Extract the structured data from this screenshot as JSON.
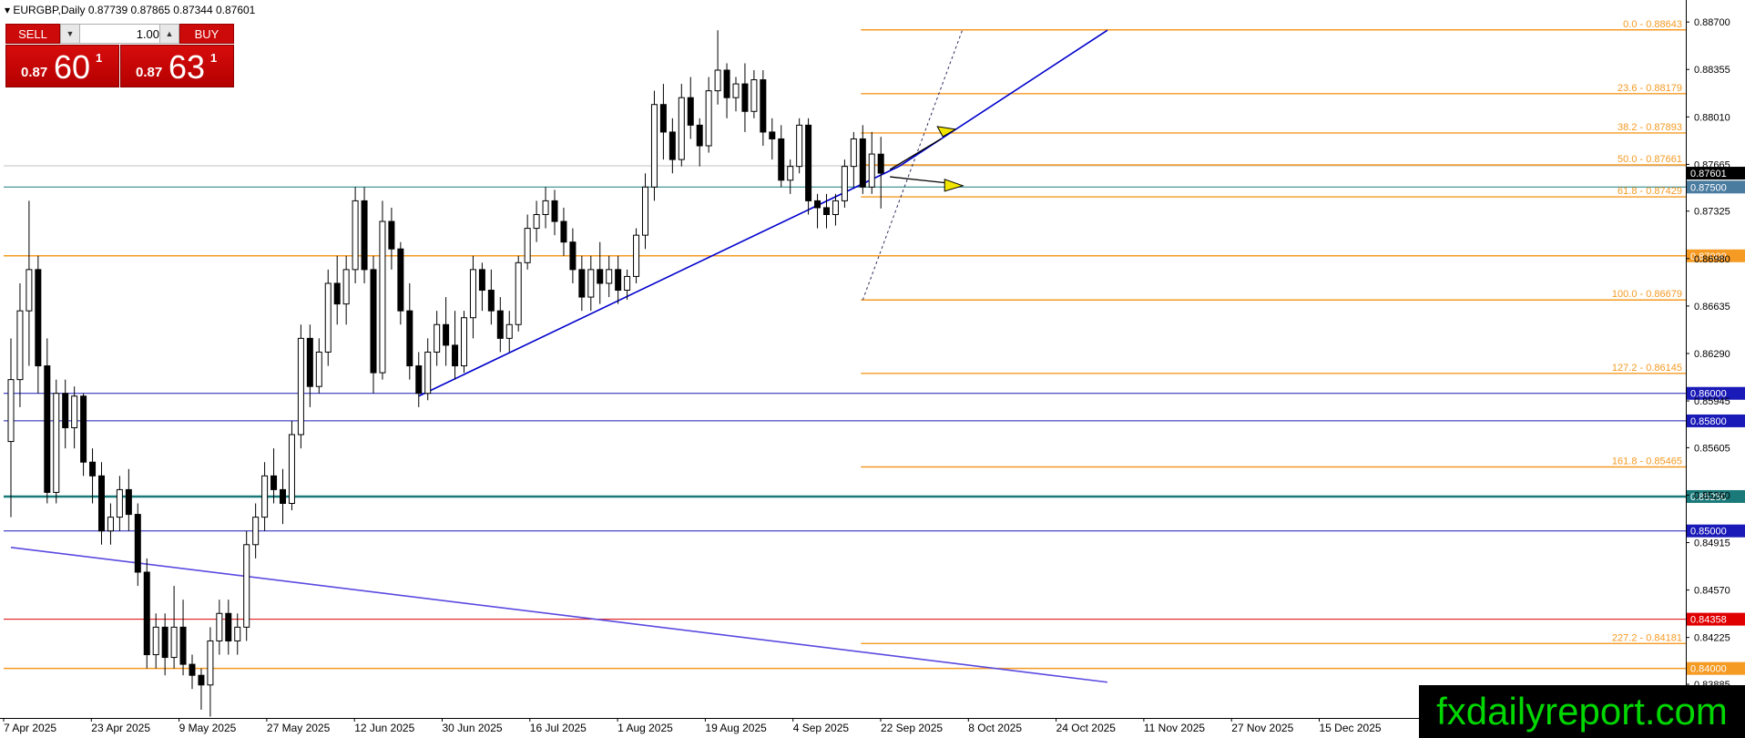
{
  "symbol_info": "EURGBP,Daily  0.87739 0.87865 0.87344 0.87601",
  "trade_panel": {
    "sell_label": "SELL",
    "buy_label": "BUY",
    "lot_value": "1.00",
    "sell_price": {
      "prefix": "0.87",
      "big": "60",
      "sup": "1"
    },
    "buy_price": {
      "prefix": "0.87",
      "big": "63",
      "sup": "1"
    }
  },
  "watermark": "fxdailyreport.com",
  "colors": {
    "fib": "#f59a23",
    "blue_level": "#1a1ab8",
    "teal_level": "#1a7a7a",
    "red_level": "#e00000",
    "trendline": "#0000cc",
    "candle": "#000000"
  },
  "chart_data": {
    "type": "candlestick",
    "symbol": "EURGBP",
    "timeframe": "Daily",
    "ohlc_header": {
      "open": 0.87739,
      "high": 0.87865,
      "low": 0.87344,
      "close": 0.87601
    },
    "price_axis_ticks": [
      "0.88700",
      "0.88355",
      "0.88010",
      "0.87665",
      "0.87325",
      "0.86980",
      "0.86635",
      "0.86290",
      "0.85945",
      "0.85605",
      "0.85260",
      "0.84915",
      "0.84570",
      "0.84225",
      "0.83885"
    ],
    "ylim": [
      0.8364,
      0.8886
    ],
    "time_axis_labels": [
      "7 Apr 2025",
      "23 Apr 2025",
      "9 May 2025",
      "27 May 2025",
      "12 Jun 2025",
      "30 Jun 2025",
      "16 Jul 2025",
      "1 Aug 2025",
      "19 Aug 2025",
      "4 Sep 2025",
      "22 Sep 2025",
      "8 Oct 2025",
      "24 Oct 2025",
      "11 Nov 2025",
      "27 Nov 2025",
      "15 Dec 2025"
    ],
    "fib_levels": [
      {
        "ratio": "0.0",
        "price": 0.88643,
        "label": "0.0 - 0.88643"
      },
      {
        "ratio": "23.6",
        "price": 0.88179,
        "label": "23.6 - 0.88179"
      },
      {
        "ratio": "38.2",
        "price": 0.87893,
        "label": "38.2 - 0.87893"
      },
      {
        "ratio": "50.0",
        "price": 0.87661,
        "label": "50.0 - 0.87661"
      },
      {
        "ratio": "61.8",
        "price": 0.87429,
        "label": "61.8 - 0.87429"
      },
      {
        "ratio": "100.0",
        "price": 0.86679,
        "label": "100.0 - 0.86679"
      },
      {
        "ratio": "127.2",
        "price": 0.86145,
        "label": "127.2 - 0.86145"
      },
      {
        "ratio": "161.8",
        "price": 0.85465,
        "label": "161.8 - 0.85465"
      },
      {
        "ratio": "227.2",
        "price": 0.84181,
        "label": "227.2 - 0.84181"
      }
    ],
    "horizontal_levels": [
      {
        "price": 0.875,
        "label": "0.87500",
        "style": "teal-thin"
      },
      {
        "price": 0.87,
        "label": "0.87000",
        "style": "orange"
      },
      {
        "price": 0.86,
        "label": "0.86000",
        "style": "blue"
      },
      {
        "price": 0.858,
        "label": "0.85800",
        "style": "blue"
      },
      {
        "price": 0.8525,
        "label": "0.85250",
        "style": "teal-thick"
      },
      {
        "price": 0.85,
        "label": "0.85000",
        "style": "blue"
      },
      {
        "price": 0.84358,
        "label": "0.84358",
        "style": "red"
      },
      {
        "price": 0.84,
        "label": "0.84000",
        "style": "orange"
      }
    ],
    "current_price": {
      "price": 0.87601,
      "label": "0.87601"
    },
    "candles": [
      {
        "o": 0.8565,
        "h": 0.864,
        "l": 0.851,
        "c": 0.861
      },
      {
        "o": 0.861,
        "h": 0.868,
        "l": 0.859,
        "c": 0.866
      },
      {
        "o": 0.866,
        "h": 0.874,
        "l": 0.862,
        "c": 0.869
      },
      {
        "o": 0.869,
        "h": 0.87,
        "l": 0.86,
        "c": 0.862
      },
      {
        "o": 0.862,
        "h": 0.864,
        "l": 0.852,
        "c": 0.8528
      },
      {
        "o": 0.8528,
        "h": 0.861,
        "l": 0.852,
        "c": 0.86
      },
      {
        "o": 0.86,
        "h": 0.861,
        "l": 0.856,
        "c": 0.8575
      },
      {
        "o": 0.8575,
        "h": 0.8605,
        "l": 0.856,
        "c": 0.8598
      },
      {
        "o": 0.8598,
        "h": 0.86,
        "l": 0.854,
        "c": 0.855
      },
      {
        "o": 0.855,
        "h": 0.856,
        "l": 0.852,
        "c": 0.854
      },
      {
        "o": 0.854,
        "h": 0.855,
        "l": 0.849,
        "c": 0.85
      },
      {
        "o": 0.85,
        "h": 0.852,
        "l": 0.849,
        "c": 0.851
      },
      {
        "o": 0.851,
        "h": 0.854,
        "l": 0.85,
        "c": 0.853
      },
      {
        "o": 0.853,
        "h": 0.8545,
        "l": 0.85,
        "c": 0.8512
      },
      {
        "o": 0.8512,
        "h": 0.852,
        "l": 0.846,
        "c": 0.847
      },
      {
        "o": 0.847,
        "h": 0.848,
        "l": 0.84,
        "c": 0.841
      },
      {
        "o": 0.841,
        "h": 0.844,
        "l": 0.84,
        "c": 0.843
      },
      {
        "o": 0.843,
        "h": 0.844,
        "l": 0.8395,
        "c": 0.8408
      },
      {
        "o": 0.8408,
        "h": 0.846,
        "l": 0.84,
        "c": 0.843
      },
      {
        "o": 0.843,
        "h": 0.845,
        "l": 0.8395,
        "c": 0.8403
      },
      {
        "o": 0.8403,
        "h": 0.841,
        "l": 0.8385,
        "c": 0.8395
      },
      {
        "o": 0.8395,
        "h": 0.84,
        "l": 0.837,
        "c": 0.8388
      },
      {
        "o": 0.8388,
        "h": 0.843,
        "l": 0.8365,
        "c": 0.842
      },
      {
        "o": 0.842,
        "h": 0.845,
        "l": 0.841,
        "c": 0.844
      },
      {
        "o": 0.844,
        "h": 0.845,
        "l": 0.841,
        "c": 0.842
      },
      {
        "o": 0.842,
        "h": 0.844,
        "l": 0.841,
        "c": 0.843
      },
      {
        "o": 0.843,
        "h": 0.85,
        "l": 0.842,
        "c": 0.849
      },
      {
        "o": 0.849,
        "h": 0.852,
        "l": 0.848,
        "c": 0.851
      },
      {
        "o": 0.851,
        "h": 0.855,
        "l": 0.85,
        "c": 0.854
      },
      {
        "o": 0.854,
        "h": 0.856,
        "l": 0.852,
        "c": 0.853
      },
      {
        "o": 0.853,
        "h": 0.8545,
        "l": 0.8505,
        "c": 0.852
      },
      {
        "o": 0.852,
        "h": 0.858,
        "l": 0.8515,
        "c": 0.857
      },
      {
        "o": 0.857,
        "h": 0.865,
        "l": 0.856,
        "c": 0.864
      },
      {
        "o": 0.864,
        "h": 0.865,
        "l": 0.859,
        "c": 0.8605
      },
      {
        "o": 0.8605,
        "h": 0.864,
        "l": 0.86,
        "c": 0.863
      },
      {
        "o": 0.863,
        "h": 0.869,
        "l": 0.862,
        "c": 0.868
      },
      {
        "o": 0.868,
        "h": 0.87,
        "l": 0.865,
        "c": 0.8665
      },
      {
        "o": 0.8665,
        "h": 0.87,
        "l": 0.865,
        "c": 0.869
      },
      {
        "o": 0.869,
        "h": 0.875,
        "l": 0.868,
        "c": 0.874
      },
      {
        "o": 0.874,
        "h": 0.875,
        "l": 0.868,
        "c": 0.869
      },
      {
        "o": 0.869,
        "h": 0.87,
        "l": 0.86,
        "c": 0.8615
      },
      {
        "o": 0.8615,
        "h": 0.874,
        "l": 0.861,
        "c": 0.8725
      },
      {
        "o": 0.8725,
        "h": 0.8735,
        "l": 0.869,
        "c": 0.8705
      },
      {
        "o": 0.8705,
        "h": 0.871,
        "l": 0.865,
        "c": 0.866
      },
      {
        "o": 0.866,
        "h": 0.868,
        "l": 0.861,
        "c": 0.862
      },
      {
        "o": 0.862,
        "h": 0.863,
        "l": 0.859,
        "c": 0.86
      },
      {
        "o": 0.86,
        "h": 0.864,
        "l": 0.8595,
        "c": 0.863
      },
      {
        "o": 0.863,
        "h": 0.866,
        "l": 0.862,
        "c": 0.865
      },
      {
        "o": 0.865,
        "h": 0.867,
        "l": 0.862,
        "c": 0.8635
      },
      {
        "o": 0.8635,
        "h": 0.866,
        "l": 0.861,
        "c": 0.862
      },
      {
        "o": 0.862,
        "h": 0.866,
        "l": 0.8615,
        "c": 0.8655
      },
      {
        "o": 0.8655,
        "h": 0.87,
        "l": 0.864,
        "c": 0.869
      },
      {
        "o": 0.869,
        "h": 0.8695,
        "l": 0.866,
        "c": 0.8675
      },
      {
        "o": 0.8675,
        "h": 0.869,
        "l": 0.865,
        "c": 0.866
      },
      {
        "o": 0.866,
        "h": 0.867,
        "l": 0.863,
        "c": 0.864
      },
      {
        "o": 0.864,
        "h": 0.866,
        "l": 0.863,
        "c": 0.865
      },
      {
        "o": 0.865,
        "h": 0.87,
        "l": 0.8645,
        "c": 0.8695
      },
      {
        "o": 0.8695,
        "h": 0.873,
        "l": 0.869,
        "c": 0.872
      },
      {
        "o": 0.872,
        "h": 0.874,
        "l": 0.871,
        "c": 0.873
      },
      {
        "o": 0.873,
        "h": 0.875,
        "l": 0.872,
        "c": 0.874
      },
      {
        "o": 0.874,
        "h": 0.8748,
        "l": 0.8715,
        "c": 0.8725
      },
      {
        "o": 0.8725,
        "h": 0.8735,
        "l": 0.87,
        "c": 0.871
      },
      {
        "o": 0.871,
        "h": 0.872,
        "l": 0.868,
        "c": 0.869
      },
      {
        "o": 0.869,
        "h": 0.87,
        "l": 0.866,
        "c": 0.867
      },
      {
        "o": 0.867,
        "h": 0.87,
        "l": 0.866,
        "c": 0.869
      },
      {
        "o": 0.869,
        "h": 0.871,
        "l": 0.8665,
        "c": 0.868
      },
      {
        "o": 0.868,
        "h": 0.87,
        "l": 0.867,
        "c": 0.869
      },
      {
        "o": 0.869,
        "h": 0.87,
        "l": 0.8665,
        "c": 0.8675
      },
      {
        "o": 0.8675,
        "h": 0.869,
        "l": 0.8668,
        "c": 0.8685
      },
      {
        "o": 0.8685,
        "h": 0.872,
        "l": 0.868,
        "c": 0.8715
      },
      {
        "o": 0.8715,
        "h": 0.876,
        "l": 0.8705,
        "c": 0.875
      },
      {
        "o": 0.875,
        "h": 0.882,
        "l": 0.874,
        "c": 0.881
      },
      {
        "o": 0.881,
        "h": 0.8825,
        "l": 0.877,
        "c": 0.879
      },
      {
        "o": 0.879,
        "h": 0.88,
        "l": 0.876,
        "c": 0.877
      },
      {
        "o": 0.877,
        "h": 0.8825,
        "l": 0.8765,
        "c": 0.8815
      },
      {
        "o": 0.8815,
        "h": 0.883,
        "l": 0.8785,
        "c": 0.8795
      },
      {
        "o": 0.8795,
        "h": 0.88,
        "l": 0.8765,
        "c": 0.878
      },
      {
        "o": 0.878,
        "h": 0.883,
        "l": 0.8775,
        "c": 0.882
      },
      {
        "o": 0.882,
        "h": 0.8864,
        "l": 0.881,
        "c": 0.8835
      },
      {
        "o": 0.8835,
        "h": 0.884,
        "l": 0.88,
        "c": 0.8815
      },
      {
        "o": 0.8815,
        "h": 0.883,
        "l": 0.8805,
        "c": 0.8825
      },
      {
        "o": 0.8825,
        "h": 0.884,
        "l": 0.879,
        "c": 0.8805
      },
      {
        "o": 0.8805,
        "h": 0.8835,
        "l": 0.88,
        "c": 0.8828
      },
      {
        "o": 0.8828,
        "h": 0.8835,
        "l": 0.878,
        "c": 0.879
      },
      {
        "o": 0.879,
        "h": 0.88,
        "l": 0.877,
        "c": 0.8785
      },
      {
        "o": 0.8785,
        "h": 0.8795,
        "l": 0.875,
        "c": 0.8755
      },
      {
        "o": 0.8755,
        "h": 0.877,
        "l": 0.8745,
        "c": 0.8765
      },
      {
        "o": 0.8765,
        "h": 0.88,
        "l": 0.876,
        "c": 0.8795
      },
      {
        "o": 0.8795,
        "h": 0.88,
        "l": 0.873,
        "c": 0.874
      },
      {
        "o": 0.874,
        "h": 0.8745,
        "l": 0.872,
        "c": 0.8735
      },
      {
        "o": 0.8735,
        "h": 0.8745,
        "l": 0.872,
        "c": 0.873
      },
      {
        "o": 0.873,
        "h": 0.8745,
        "l": 0.8722,
        "c": 0.874
      },
      {
        "o": 0.874,
        "h": 0.877,
        "l": 0.8735,
        "c": 0.8765
      },
      {
        "o": 0.8765,
        "h": 0.879,
        "l": 0.875,
        "c": 0.8785
      },
      {
        "o": 0.8785,
        "h": 0.8795,
        "l": 0.8745,
        "c": 0.875
      },
      {
        "o": 0.875,
        "h": 0.879,
        "l": 0.8745,
        "c": 0.8774
      },
      {
        "o": 0.87739,
        "h": 0.87865,
        "l": 0.87344,
        "c": 0.87601
      }
    ],
    "trendlines": [
      {
        "from": {
          "candle": 45,
          "price": 0.8598
        },
        "to": {
          "candle": 98,
          "price": 0.8765
        }
      },
      {
        "from": {
          "candle": 98,
          "price": 0.8765
        },
        "to": {
          "candle": 121,
          "price": 0.8864
        }
      },
      {
        "from": {
          "candle": 0,
          "price": 0.8488
        },
        "to": {
          "candle": 121,
          "price": 0.839
        }
      }
    ]
  }
}
